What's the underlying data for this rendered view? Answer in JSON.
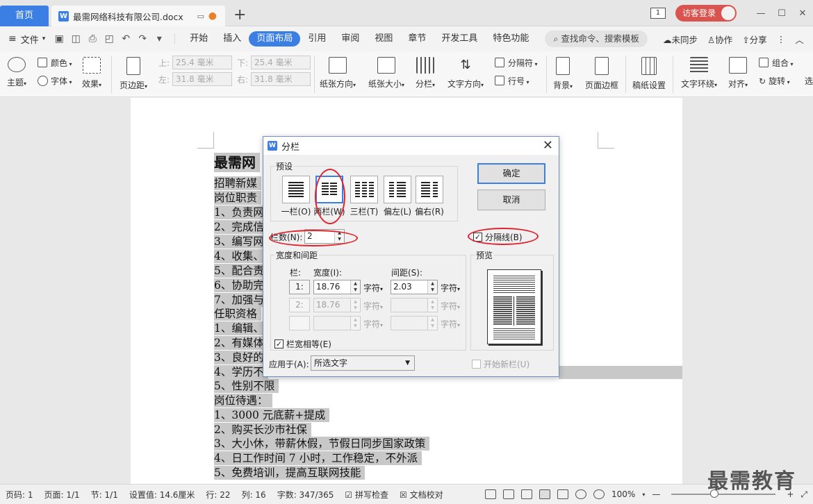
{
  "tabs": {
    "home": "首页",
    "doc": "最需网络科技有限公司.docx"
  },
  "titlebar": {
    "page_indicator": "1",
    "login": "访客登录"
  },
  "menu": {
    "file": "文件",
    "tabs": [
      "开始",
      "插入",
      "页面布局",
      "引用",
      "审阅",
      "视图",
      "章节",
      "开发工具",
      "特色功能"
    ],
    "active_tab": "页面布局",
    "search": "查找命令、搜索模板",
    "unsynced": "未同步",
    "collab": "协作",
    "share": "分享"
  },
  "ribbon": {
    "theme": "主题",
    "color": "颜色",
    "font": "字体",
    "effect": "效果",
    "margin": "页边距",
    "top_label": "上:",
    "top_val": "25.4 毫米",
    "bottom_label": "下:",
    "bottom_val": "25.4 毫米",
    "left_label": "左:",
    "left_val": "31.8 毫米",
    "right_label": "右:",
    "right_val": "31.8 毫米",
    "orientation": "纸张方向",
    "size": "纸张大小",
    "columns": "分栏",
    "text_dir": "文字方向",
    "breaks": "分隔符",
    "line_num": "行号",
    "background": "背景",
    "border": "页面边框",
    "manuscript": "稿纸设置",
    "wrap": "文字环绕",
    "align": "对齐",
    "group": "组合",
    "rotate": "旋转",
    "select": "选"
  },
  "document": {
    "title": "最需网",
    "lines": [
      "招聘新媒",
      "岗位职责",
      "1、负责网",
      "2、完成信",
      "3、编写网",
      "4、收集、",
      "5、配合责",
      "6、协助完",
      "7、加强与",
      "任职资格",
      "1、编辑、",
      "2、有媒体",
      "3、良好的",
      "4、学历不",
      "5、性别不限",
      "岗位待遇：",
      "1、3000 元底薪+提成",
      "2、购买长沙市社保",
      "3、大小休，带薪休假，节假日同步国家政策",
      "4、日工作时间 7 小时，工作稳定，不外派",
      "5、免费培训，提高互联网技能"
    ]
  },
  "dialog": {
    "title": "分栏",
    "preset_label": "预设",
    "presets": [
      "一栏(O)",
      "两栏(W)",
      "三栏(T)",
      "偏左(L)",
      "偏右(R)"
    ],
    "ok": "确定",
    "cancel": "取消",
    "num_label": "栏数(N):",
    "num_val": "2",
    "divider": "分隔线(B)",
    "width_spacing": "宽度和间距",
    "col_label": "栏:",
    "width_label": "宽度(I):",
    "spacing_label": "间距(S):",
    "row1_num": "1:",
    "row1_width": "18.76",
    "row1_unit": "字符",
    "row1_spacing": "2.03",
    "row1_unit2": "字符",
    "row2_num": "2:",
    "row2_width": "18.76",
    "unit_dis": "字符",
    "equal_width": "栏宽相等(E)",
    "preview": "预览",
    "apply_label": "应用于(A):",
    "apply_val": "所选文字",
    "new_col": "开始新栏(U)"
  },
  "statusbar": {
    "page_code": "页码: 1",
    "page": "页面: 1/1",
    "section": "节: 1/1",
    "setting": "设置值: 14.6厘米",
    "row": "行: 22",
    "col": "列: 16",
    "words": "字数: 347/365",
    "spell": "拼写检查",
    "proof": "文档校对",
    "zoom": "100%"
  },
  "watermark": "最需教育",
  "colors": {
    "accent": "#3b7fe4",
    "annotation": "#e0242f",
    "login": "#d9534f"
  }
}
